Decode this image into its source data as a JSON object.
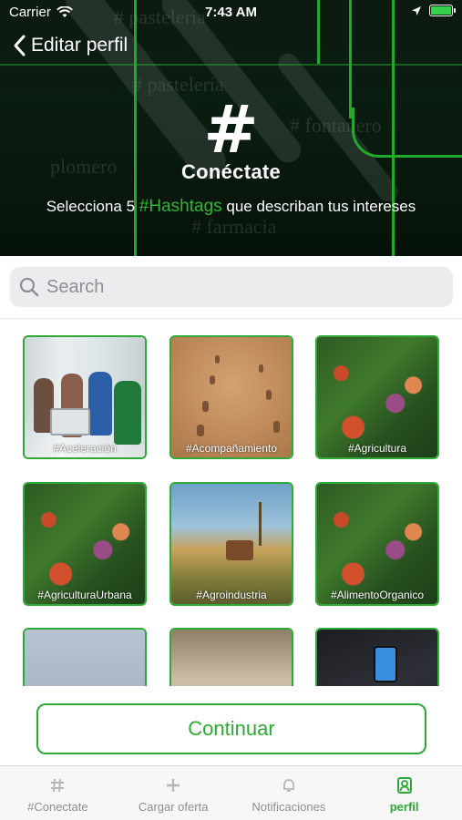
{
  "status_bar": {
    "carrier": "Carrier",
    "time": "7:43 AM"
  },
  "nav": {
    "back_label": "Editar perfil"
  },
  "brand": {
    "logo_glyph": "#",
    "name": "Conéctate"
  },
  "subtitle": {
    "pre": "Selecciona 5 ",
    "highlight": "#Hashtags",
    "post": " que describan tus intereses"
  },
  "background_words": [
    "# pastelería",
    "# pastelería",
    "# fontanero",
    "plomero",
    "# farmacia"
  ],
  "search": {
    "placeholder": "Search",
    "value": ""
  },
  "tiles": [
    {
      "label": "#Aceleración",
      "image": "office-team"
    },
    {
      "label": "#Acompañamiento",
      "image": "footprints-sand"
    },
    {
      "label": "#Agricultura",
      "image": "vegetables"
    },
    {
      "label": "#AgriculturaUrbana",
      "image": "vegetables"
    },
    {
      "label": "#Agroindustria",
      "image": "tractor-field"
    },
    {
      "label": "#AlimentoOrganico",
      "image": "vegetables"
    },
    {
      "label": "",
      "image": "people-outdoors"
    },
    {
      "label": "",
      "image": "sheep"
    },
    {
      "label": "",
      "image": "phone-cafe"
    }
  ],
  "continue_label": "Continuar",
  "tabs": [
    {
      "label": "#Conectate",
      "icon": "hashtag-icon",
      "active": false
    },
    {
      "label": "Cargar oferta",
      "icon": "plus-icon",
      "active": false
    },
    {
      "label": "Notificaciones",
      "icon": "bell-icon",
      "active": false
    },
    {
      "label": "perfil",
      "icon": "profile-icon",
      "active": true
    }
  ],
  "colors": {
    "accent": "#2ea836",
    "hero_bg": "#0a1d11"
  }
}
